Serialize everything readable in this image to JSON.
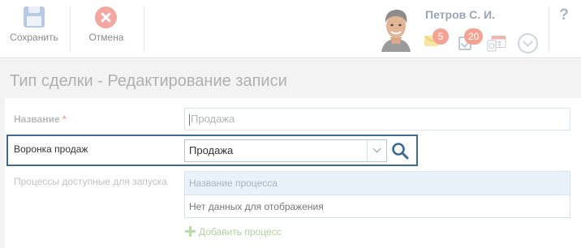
{
  "toolbar": {
    "save_label": "Сохранить",
    "cancel_label": "Отмена",
    "save_icon": "floppy-disk-icon",
    "cancel_icon": "close-circle-icon"
  },
  "user": {
    "name": "Петров С. И.",
    "mail_count": "5",
    "task_count": "20",
    "icons": [
      "mail-icon",
      "tasks-icon",
      "calendar-icon",
      "chevron-down-icon",
      "help-icon"
    ]
  },
  "help_label": "?",
  "page": {
    "title": "Тип сделки - Редактирование записи"
  },
  "form": {
    "name_label": "Название",
    "required_mark": "*",
    "name_value": "Продажа",
    "funnel_label": "Воронка продаж",
    "funnel_value": "Продажа",
    "processes_label": "Процессы доступные для запуска",
    "processes_column": "Название процесса",
    "processes_empty": "Нет данных для отображения",
    "add_process_label": "Добавить процесс"
  },
  "colors": {
    "accent_border": "#3d6b96",
    "badge": "#f4a393",
    "cancel": "#f4a7a1",
    "save": "#b8cbe4",
    "add_green": "#b9dba6"
  }
}
